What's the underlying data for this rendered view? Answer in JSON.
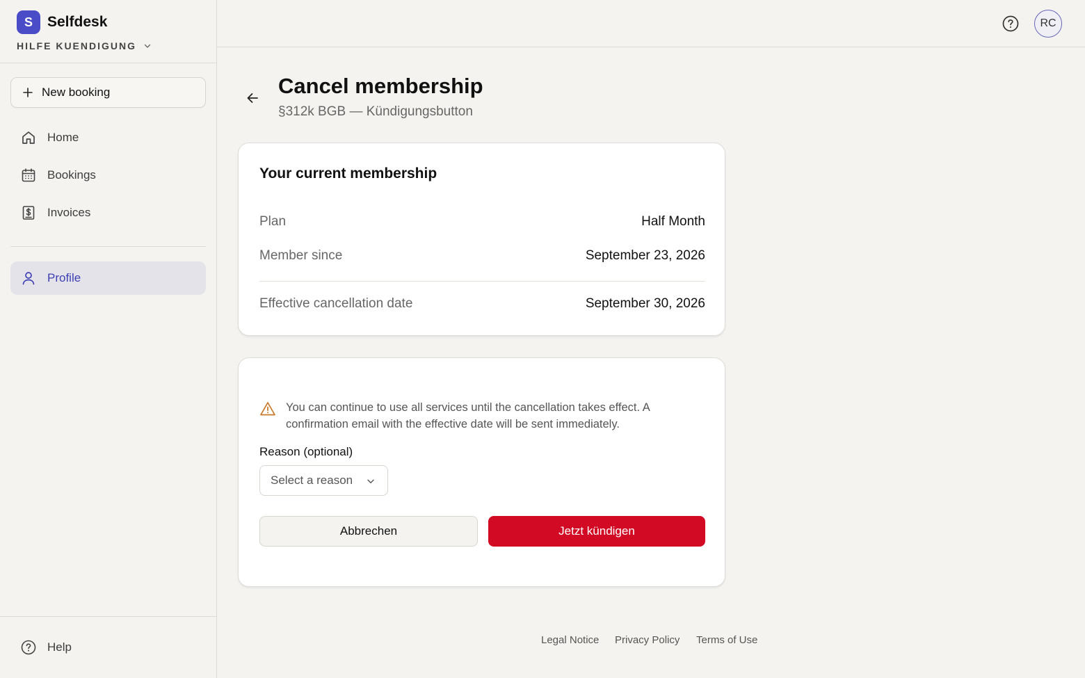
{
  "brand": {
    "logo_letter": "S",
    "name": "Selfdesk",
    "workspace": "HILFE KUENDIGUNG"
  },
  "sidebar": {
    "new_booking_label": "New booking",
    "items": [
      {
        "label": "Home",
        "icon": "home-icon"
      },
      {
        "label": "Bookings",
        "icon": "calendar-icon"
      },
      {
        "label": "Invoices",
        "icon": "invoice-icon"
      },
      {
        "label": "Profile",
        "icon": "user-icon",
        "active": true
      }
    ],
    "help_label": "Help"
  },
  "topbar": {
    "avatar_initials": "RC"
  },
  "header": {
    "title": "Cancel membership",
    "subtitle": "§312k BGB — Kündigungsbutton"
  },
  "membership": {
    "title": "Your current membership",
    "rows": [
      {
        "label": "Plan",
        "value": "Half Month"
      },
      {
        "label": "Member since",
        "value": "September 23, 2026"
      },
      {
        "label": "Effective cancellation date",
        "value": "September 30, 2026"
      }
    ]
  },
  "cancel_form": {
    "warning": "You can continue to use all services until the cancellation takes effect. A confirmation email with the effective date will be sent immediately.",
    "reason_label": "Reason (optional)",
    "reason_placeholder": "Select a reason",
    "cancel_label": "Abbrechen",
    "confirm_label": "Jetzt kündigen"
  },
  "footer": {
    "links": [
      "Legal Notice",
      "Privacy Policy",
      "Terms of Use"
    ]
  },
  "colors": {
    "accent": "#4a4bc6",
    "danger": "#d20a23",
    "active_bg": "#e5e3ea",
    "warning": "#c9782a"
  }
}
